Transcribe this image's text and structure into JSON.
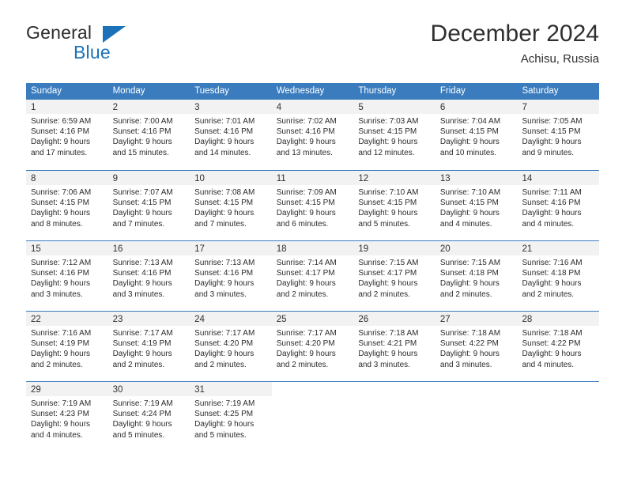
{
  "brand": {
    "name_top": "General",
    "name_bottom": "Blue",
    "accent_color": "#1c72b8"
  },
  "header": {
    "title": "December 2024",
    "subtitle": "Achisu, Russia"
  },
  "theme": {
    "header_row_color": "#3a7cbe",
    "day_band_color": "#f2f2f2",
    "text_color": "#2b2b2b"
  },
  "weekdays": [
    "Sunday",
    "Monday",
    "Tuesday",
    "Wednesday",
    "Thursday",
    "Friday",
    "Saturday"
  ],
  "weeks": [
    [
      {
        "day": "1",
        "sunrise": "Sunrise: 6:59 AM",
        "sunset": "Sunset: 4:16 PM",
        "daylight1": "Daylight: 9 hours",
        "daylight2": "and 17 minutes."
      },
      {
        "day": "2",
        "sunrise": "Sunrise: 7:00 AM",
        "sunset": "Sunset: 4:16 PM",
        "daylight1": "Daylight: 9 hours",
        "daylight2": "and 15 minutes."
      },
      {
        "day": "3",
        "sunrise": "Sunrise: 7:01 AM",
        "sunset": "Sunset: 4:16 PM",
        "daylight1": "Daylight: 9 hours",
        "daylight2": "and 14 minutes."
      },
      {
        "day": "4",
        "sunrise": "Sunrise: 7:02 AM",
        "sunset": "Sunset: 4:16 PM",
        "daylight1": "Daylight: 9 hours",
        "daylight2": "and 13 minutes."
      },
      {
        "day": "5",
        "sunrise": "Sunrise: 7:03 AM",
        "sunset": "Sunset: 4:15 PM",
        "daylight1": "Daylight: 9 hours",
        "daylight2": "and 12 minutes."
      },
      {
        "day": "6",
        "sunrise": "Sunrise: 7:04 AM",
        "sunset": "Sunset: 4:15 PM",
        "daylight1": "Daylight: 9 hours",
        "daylight2": "and 10 minutes."
      },
      {
        "day": "7",
        "sunrise": "Sunrise: 7:05 AM",
        "sunset": "Sunset: 4:15 PM",
        "daylight1": "Daylight: 9 hours",
        "daylight2": "and 9 minutes."
      }
    ],
    [
      {
        "day": "8",
        "sunrise": "Sunrise: 7:06 AM",
        "sunset": "Sunset: 4:15 PM",
        "daylight1": "Daylight: 9 hours",
        "daylight2": "and 8 minutes."
      },
      {
        "day": "9",
        "sunrise": "Sunrise: 7:07 AM",
        "sunset": "Sunset: 4:15 PM",
        "daylight1": "Daylight: 9 hours",
        "daylight2": "and 7 minutes."
      },
      {
        "day": "10",
        "sunrise": "Sunrise: 7:08 AM",
        "sunset": "Sunset: 4:15 PM",
        "daylight1": "Daylight: 9 hours",
        "daylight2": "and 7 minutes."
      },
      {
        "day": "11",
        "sunrise": "Sunrise: 7:09 AM",
        "sunset": "Sunset: 4:15 PM",
        "daylight1": "Daylight: 9 hours",
        "daylight2": "and 6 minutes."
      },
      {
        "day": "12",
        "sunrise": "Sunrise: 7:10 AM",
        "sunset": "Sunset: 4:15 PM",
        "daylight1": "Daylight: 9 hours",
        "daylight2": "and 5 minutes."
      },
      {
        "day": "13",
        "sunrise": "Sunrise: 7:10 AM",
        "sunset": "Sunset: 4:15 PM",
        "daylight1": "Daylight: 9 hours",
        "daylight2": "and 4 minutes."
      },
      {
        "day": "14",
        "sunrise": "Sunrise: 7:11 AM",
        "sunset": "Sunset: 4:16 PM",
        "daylight1": "Daylight: 9 hours",
        "daylight2": "and 4 minutes."
      }
    ],
    [
      {
        "day": "15",
        "sunrise": "Sunrise: 7:12 AM",
        "sunset": "Sunset: 4:16 PM",
        "daylight1": "Daylight: 9 hours",
        "daylight2": "and 3 minutes."
      },
      {
        "day": "16",
        "sunrise": "Sunrise: 7:13 AM",
        "sunset": "Sunset: 4:16 PM",
        "daylight1": "Daylight: 9 hours",
        "daylight2": "and 3 minutes."
      },
      {
        "day": "17",
        "sunrise": "Sunrise: 7:13 AM",
        "sunset": "Sunset: 4:16 PM",
        "daylight1": "Daylight: 9 hours",
        "daylight2": "and 3 minutes."
      },
      {
        "day": "18",
        "sunrise": "Sunrise: 7:14 AM",
        "sunset": "Sunset: 4:17 PM",
        "daylight1": "Daylight: 9 hours",
        "daylight2": "and 2 minutes."
      },
      {
        "day": "19",
        "sunrise": "Sunrise: 7:15 AM",
        "sunset": "Sunset: 4:17 PM",
        "daylight1": "Daylight: 9 hours",
        "daylight2": "and 2 minutes."
      },
      {
        "day": "20",
        "sunrise": "Sunrise: 7:15 AM",
        "sunset": "Sunset: 4:18 PM",
        "daylight1": "Daylight: 9 hours",
        "daylight2": "and 2 minutes."
      },
      {
        "day": "21",
        "sunrise": "Sunrise: 7:16 AM",
        "sunset": "Sunset: 4:18 PM",
        "daylight1": "Daylight: 9 hours",
        "daylight2": "and 2 minutes."
      }
    ],
    [
      {
        "day": "22",
        "sunrise": "Sunrise: 7:16 AM",
        "sunset": "Sunset: 4:19 PM",
        "daylight1": "Daylight: 9 hours",
        "daylight2": "and 2 minutes."
      },
      {
        "day": "23",
        "sunrise": "Sunrise: 7:17 AM",
        "sunset": "Sunset: 4:19 PM",
        "daylight1": "Daylight: 9 hours",
        "daylight2": "and 2 minutes."
      },
      {
        "day": "24",
        "sunrise": "Sunrise: 7:17 AM",
        "sunset": "Sunset: 4:20 PM",
        "daylight1": "Daylight: 9 hours",
        "daylight2": "and 2 minutes."
      },
      {
        "day": "25",
        "sunrise": "Sunrise: 7:17 AM",
        "sunset": "Sunset: 4:20 PM",
        "daylight1": "Daylight: 9 hours",
        "daylight2": "and 2 minutes."
      },
      {
        "day": "26",
        "sunrise": "Sunrise: 7:18 AM",
        "sunset": "Sunset: 4:21 PM",
        "daylight1": "Daylight: 9 hours",
        "daylight2": "and 3 minutes."
      },
      {
        "day": "27",
        "sunrise": "Sunrise: 7:18 AM",
        "sunset": "Sunset: 4:22 PM",
        "daylight1": "Daylight: 9 hours",
        "daylight2": "and 3 minutes."
      },
      {
        "day": "28",
        "sunrise": "Sunrise: 7:18 AM",
        "sunset": "Sunset: 4:22 PM",
        "daylight1": "Daylight: 9 hours",
        "daylight2": "and 4 minutes."
      }
    ],
    [
      {
        "day": "29",
        "sunrise": "Sunrise: 7:19 AM",
        "sunset": "Sunset: 4:23 PM",
        "daylight1": "Daylight: 9 hours",
        "daylight2": "and 4 minutes."
      },
      {
        "day": "30",
        "sunrise": "Sunrise: 7:19 AM",
        "sunset": "Sunset: 4:24 PM",
        "daylight1": "Daylight: 9 hours",
        "daylight2": "and 5 minutes."
      },
      {
        "day": "31",
        "sunrise": "Sunrise: 7:19 AM",
        "sunset": "Sunset: 4:25 PM",
        "daylight1": "Daylight: 9 hours",
        "daylight2": "and 5 minutes."
      },
      {
        "day": "",
        "sunrise": "",
        "sunset": "",
        "daylight1": "",
        "daylight2": ""
      },
      {
        "day": "",
        "sunrise": "",
        "sunset": "",
        "daylight1": "",
        "daylight2": ""
      },
      {
        "day": "",
        "sunrise": "",
        "sunset": "",
        "daylight1": "",
        "daylight2": ""
      },
      {
        "day": "",
        "sunrise": "",
        "sunset": "",
        "daylight1": "",
        "daylight2": ""
      }
    ]
  ]
}
